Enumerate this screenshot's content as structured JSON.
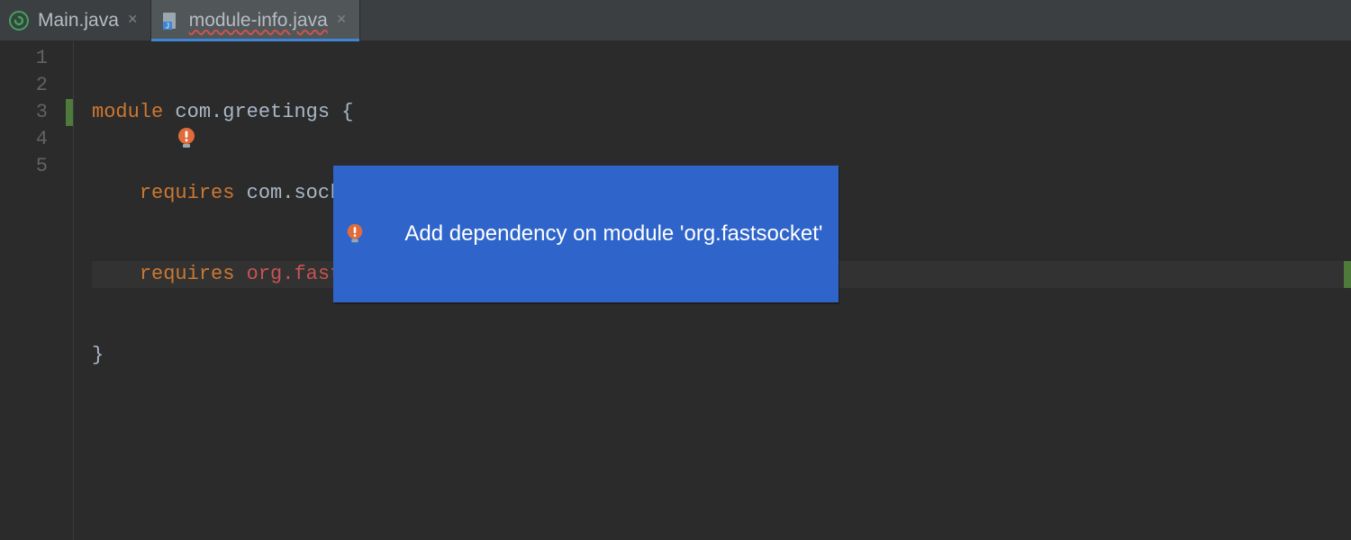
{
  "tabs": [
    {
      "label": "Main.java",
      "active": false
    },
    {
      "label": "module-info.java",
      "active": true
    }
  ],
  "gutter": {
    "lines": [
      "1",
      "2",
      "3",
      "4",
      "5"
    ]
  },
  "code": {
    "line1": {
      "kw": "module",
      "pkg": " com.greetings ",
      "brace": "{"
    },
    "line2": {
      "indent": "    ",
      "kw": "requires",
      "pkg": " com.socket",
      "semi": ";"
    },
    "line3": {
      "indent": "    ",
      "kw": "requires",
      "err": " org.fastsocket",
      "semi": ";"
    },
    "line4": {
      "brace": "}"
    }
  },
  "intention": {
    "label": "Add dependency on module 'org.fastsocket'"
  }
}
